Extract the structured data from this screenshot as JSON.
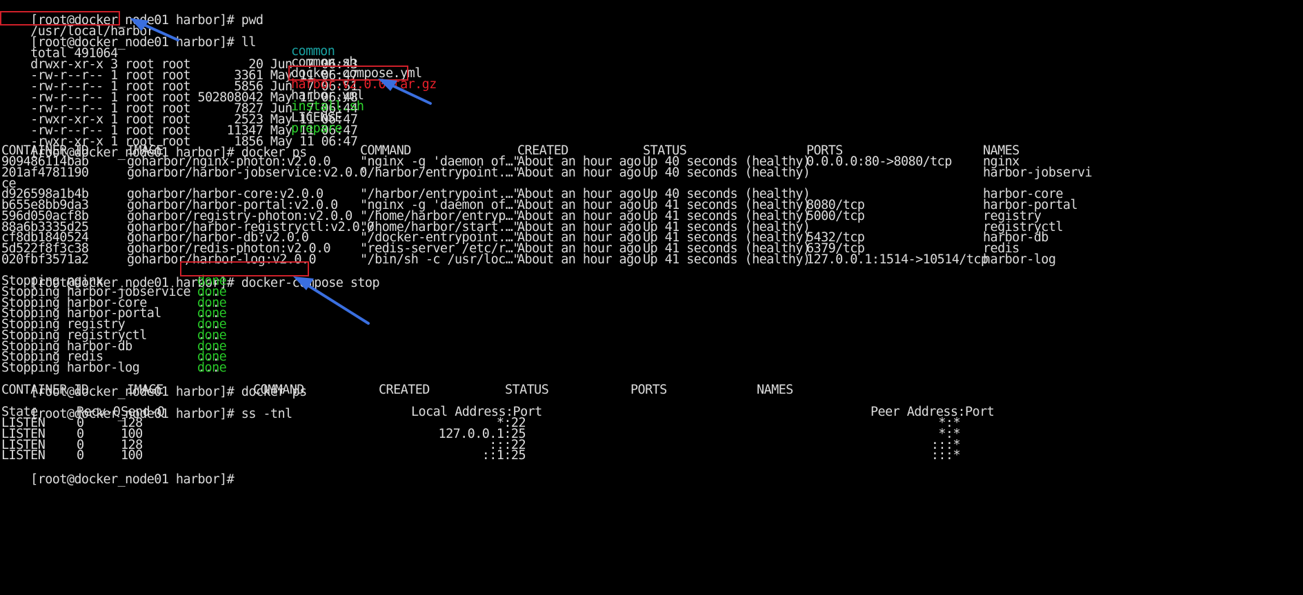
{
  "terminal": {
    "prompt": "[root@docker_node01 harbor]#",
    "session": [
      {
        "cmd": "pwd"
      },
      {
        "out": "/usr/local/harbor"
      },
      {
        "cmd": "ll"
      },
      {
        "out": "total 491064"
      }
    ],
    "ll_rows": [
      {
        "meta": "drwxr-xr-x 3 root root        20 Jun  7 06:43",
        "name": "common",
        "color": "dir"
      },
      {
        "meta": "-rw-r--r-- 1 root root      3361 May 11 06:47",
        "name": "common.sh",
        "color": "plain"
      },
      {
        "meta": "-rw-r--r-- 1 root root      5856 Jun  7 06:51",
        "name": "docker-compose.yml",
        "color": "plain"
      },
      {
        "meta": "-rw-r--r-- 1 root root 502808042 May 11 06:48",
        "name": "harbor.v2.0.0.tar.gz",
        "color": "archive"
      },
      {
        "meta": "-rw-r--r-- 1 root root      7827 Jun  7 06:44",
        "name": "harbor.yml",
        "color": "plain"
      },
      {
        "meta": "-rwxr-xr-x 1 root root      2523 May 11 06:47",
        "name": "install.sh",
        "color": "exec"
      },
      {
        "meta": "-rw-r--r-- 1 root root     11347 May 11 06:47",
        "name": "LICENSE",
        "color": "plain"
      },
      {
        "meta": "-rwxr-xr-x 1 root root      1856 May 11 06:47",
        "name": "prepare",
        "color": "exec"
      }
    ],
    "docker_ps_cmd": "docker ps",
    "docker_ps_headers": [
      "CONTAINER ID",
      "IMAGE",
      "COMMAND",
      "CREATED",
      "STATUS",
      "PORTS",
      "NAMES"
    ],
    "docker_ps_rows": [
      [
        "909486114bab",
        "goharbor/nginx-photon:v2.0.0",
        "\"nginx -g 'daemon of…\"",
        "About an hour ago",
        "Up 40 seconds (healthy)",
        "0.0.0.0:80->8080/tcp",
        "nginx"
      ],
      [
        "201af4781190",
        "goharbor/harbor-jobservice:v2.0.0",
        "\"/harbor/entrypoint.…\"",
        "About an hour ago",
        "Up 40 seconds (healthy)",
        "",
        "harbor-jobservi"
      ],
      [
        "ce",
        "",
        "",
        "",
        "",
        "",
        ""
      ],
      [
        "d926598a1b4b",
        "goharbor/harbor-core:v2.0.0",
        "\"/harbor/entrypoint.…\"",
        "About an hour ago",
        "Up 40 seconds (healthy)",
        "",
        "harbor-core"
      ],
      [
        "b655e8bb9da3",
        "goharbor/harbor-portal:v2.0.0",
        "\"nginx -g 'daemon of…\"",
        "About an hour ago",
        "Up 41 seconds (healthy)",
        "8080/tcp",
        "harbor-portal"
      ],
      [
        "596d050acf8b",
        "goharbor/registry-photon:v2.0.0",
        "\"/home/harbor/entryp…\"",
        "About an hour ago",
        "Up 41 seconds (healthy)",
        "5000/tcp",
        "registry"
      ],
      [
        "88a6b3335d25",
        "goharbor/harbor-registryctl:v2.0.0",
        "\"/home/harbor/start.…\"",
        "About an hour ago",
        "Up 41 seconds (healthy)",
        "",
        "registryctl"
      ],
      [
        "cf8db1840524",
        "goharbor/harbor-db:v2.0.0",
        "\"/docker-entrypoint.…\"",
        "About an hour ago",
        "Up 41 seconds (healthy)",
        "5432/tcp",
        "harbor-db"
      ],
      [
        "5d522f8f3c38",
        "goharbor/redis-photon:v2.0.0",
        "\"redis-server /etc/r…\"",
        "About an hour ago",
        "Up 41 seconds (healthy)",
        "6379/tcp",
        "redis"
      ],
      [
        "020fbf3571a2",
        "goharbor/harbor-log:v2.0.0",
        "\"/bin/sh -c /usr/loc…\"",
        "About an hour ago",
        "Up 41 seconds (healthy)",
        "127.0.0.1:1514->10514/tcp",
        "harbor-log"
      ]
    ],
    "stop_cmd": "docker-compose stop",
    "stop_rows": [
      {
        "label": "Stopping nginx             ...",
        "status": "done"
      },
      {
        "label": "Stopping harbor-jobservice ...",
        "status": "done"
      },
      {
        "label": "Stopping harbor-core       ...",
        "status": "done"
      },
      {
        "label": "Stopping harbor-portal     ...",
        "status": "done"
      },
      {
        "label": "Stopping registry          ...",
        "status": "done"
      },
      {
        "label": "Stopping registryctl       ...",
        "status": "done"
      },
      {
        "label": "Stopping harbor-db         ...",
        "status": "done"
      },
      {
        "label": "Stopping redis             ...",
        "status": "done"
      },
      {
        "label": "Stopping harbor-log        ...",
        "status": "done"
      }
    ],
    "docker_ps2_cmd": "docker ps",
    "ss_cmd": "ss -tnl",
    "ss_headers": [
      "State",
      "Recv-Q",
      "Send-Q",
      "Local Address:Port",
      "Peer Address:Port"
    ],
    "ss_rows": [
      [
        "LISTEN",
        "0",
        "128",
        "*:22",
        "*:*"
      ],
      [
        "LISTEN",
        "0",
        "100",
        "127.0.0.1:25",
        "*:*"
      ],
      [
        "LISTEN",
        "0",
        "128",
        ":::22",
        ":::*"
      ],
      [
        "LISTEN",
        "0",
        "100",
        "::1:25",
        ":::*"
      ]
    ]
  },
  "colors": {
    "background": "#000000",
    "foreground": "#dcdcdc",
    "directory": "#1aa3a3",
    "executable": "#2ed52e",
    "archive": "#e8202a",
    "done": "#27c827",
    "highlight_box": "#d0202a",
    "annotation_arrow": "#3a6fe0"
  }
}
